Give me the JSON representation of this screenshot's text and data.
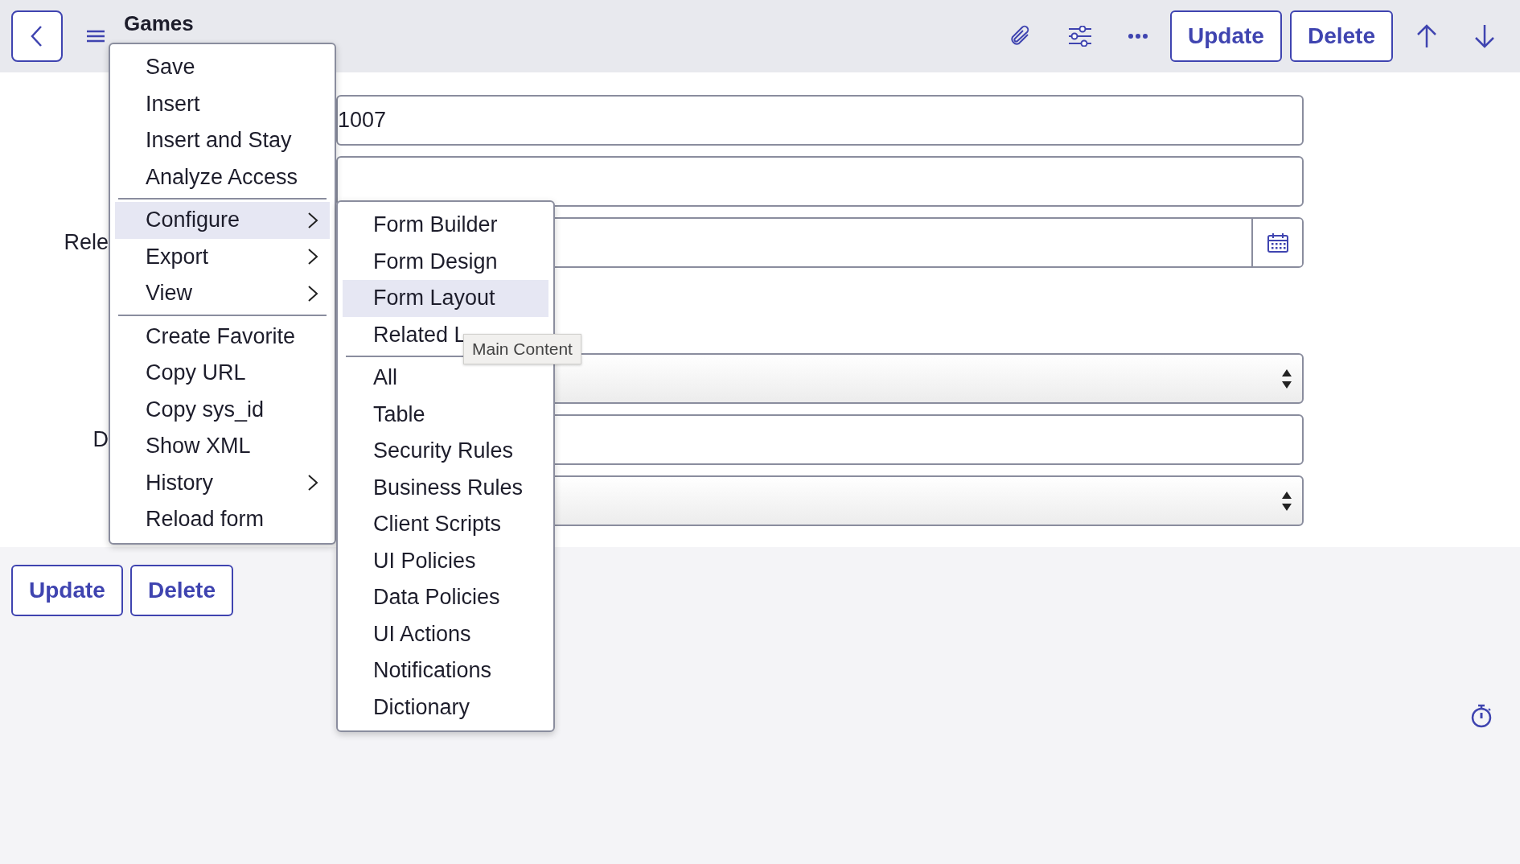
{
  "header": {
    "title": "Games",
    "actions": [
      "Update",
      "Delete"
    ]
  },
  "form": {
    "rows": [
      {
        "kind": "text",
        "label": "",
        "value": "1007"
      },
      {
        "kind": "text",
        "label": "",
        "value": ""
      },
      {
        "kind": "date",
        "label": "Rele",
        "value": ""
      },
      {
        "kind": "gap",
        "label": "",
        "value": ""
      },
      {
        "kind": "select",
        "label": "",
        "value": ""
      },
      {
        "kind": "text",
        "label": "D",
        "value": ""
      },
      {
        "kind": "select",
        "label": "",
        "value": ""
      }
    ]
  },
  "footer_buttons": [
    "Update",
    "Delete"
  ],
  "context_menu": {
    "groups": [
      [
        {
          "label": "Save",
          "selected": false,
          "has_submenu": false
        },
        {
          "label": "Insert",
          "selected": false,
          "has_submenu": false
        },
        {
          "label": "Insert and Stay",
          "selected": false,
          "has_submenu": false
        },
        {
          "label": "Analyze Access",
          "selected": false,
          "has_submenu": false
        }
      ],
      [
        {
          "label": "Configure",
          "selected": true,
          "has_submenu": true
        },
        {
          "label": "Export",
          "selected": false,
          "has_submenu": true
        },
        {
          "label": "View",
          "selected": false,
          "has_submenu": true
        }
      ],
      [
        {
          "label": "Create Favorite",
          "selected": false,
          "has_submenu": false
        },
        {
          "label": "Copy URL",
          "selected": false,
          "has_submenu": false
        },
        {
          "label": "Copy sys_id",
          "selected": false,
          "has_submenu": false
        },
        {
          "label": "Show XML",
          "selected": false,
          "has_submenu": false
        },
        {
          "label": "History",
          "selected": false,
          "has_submenu": true
        },
        {
          "label": "Reload form",
          "selected": false,
          "has_submenu": false
        }
      ]
    ]
  },
  "submenu": {
    "groups": [
      [
        {
          "label": "Form Builder",
          "selected": false
        },
        {
          "label": "Form Design",
          "selected": false
        },
        {
          "label": "Form Layout",
          "selected": true
        },
        {
          "label": "Related L",
          "selected": false
        }
      ],
      [
        {
          "label": "All",
          "selected": false
        },
        {
          "label": "Table",
          "selected": false
        },
        {
          "label": "Security Rules",
          "selected": false
        },
        {
          "label": "Business Rules",
          "selected": false
        },
        {
          "label": "Client Scripts",
          "selected": false
        },
        {
          "label": "UI Policies",
          "selected": false
        },
        {
          "label": "Data Policies",
          "selected": false
        },
        {
          "label": "UI Actions",
          "selected": false
        },
        {
          "label": "Notifications",
          "selected": false
        },
        {
          "label": "Dictionary",
          "selected": false
        }
      ]
    ]
  },
  "tooltip": "Main Content"
}
